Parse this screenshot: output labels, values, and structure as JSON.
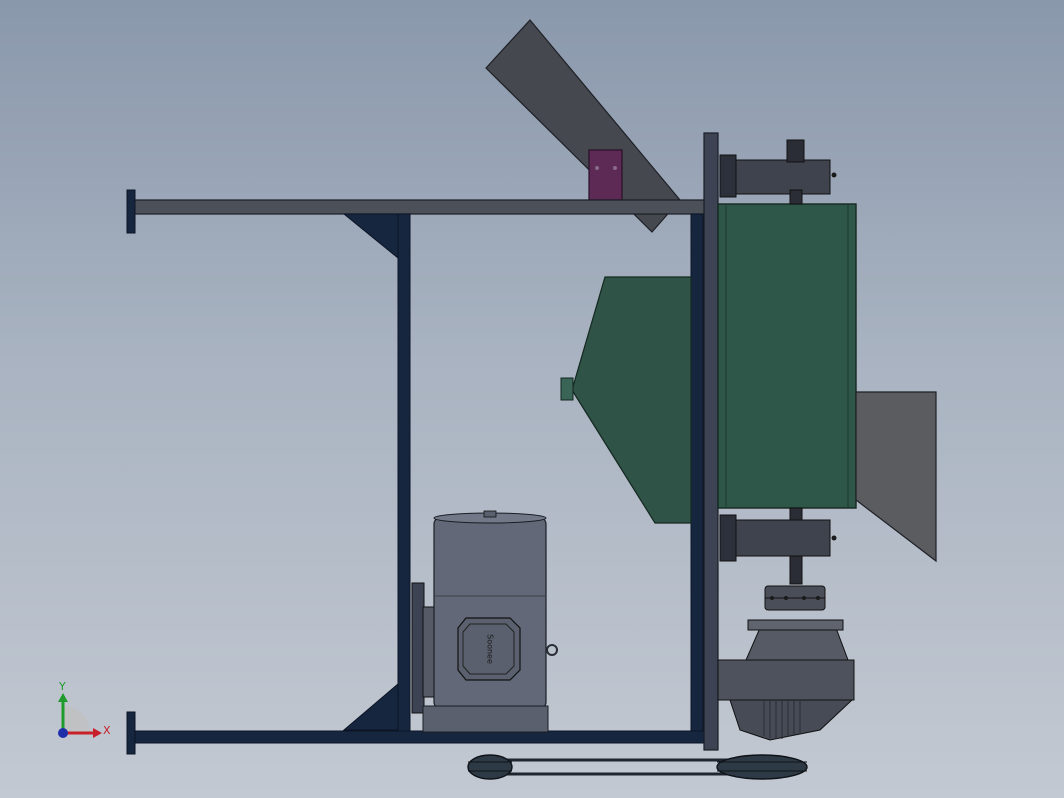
{
  "viewport": {
    "background_top": "#8a98ac",
    "background_bottom": "#c3c9d2"
  },
  "model": {
    "motor_nameplate": "Soonee",
    "colors": {
      "frame": "#16263f",
      "sheet_metal": "#4c5058",
      "chute": "#45484e",
      "enclosure": "#2f5749",
      "enclosure_front": "#2f5347",
      "motor": "#626877",
      "bracket": "#5c2a55",
      "panel": "#3d4352"
    }
  },
  "triad": {
    "x_label": "X",
    "y_label": "Y",
    "x_color": "#c8202a",
    "y_color": "#1f9a2c",
    "z_color": "#1d2fa8"
  }
}
